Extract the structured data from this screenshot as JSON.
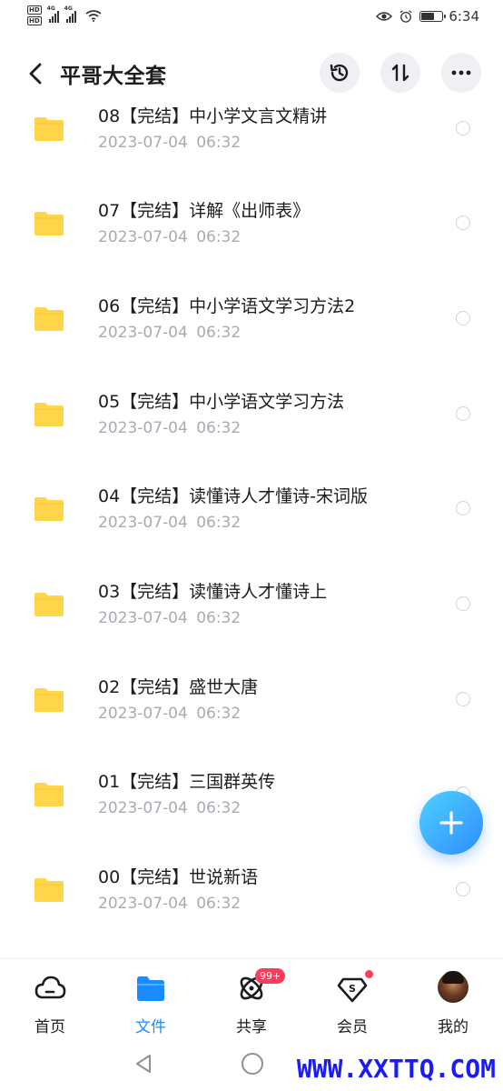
{
  "status_bar": {
    "hd1": "HD",
    "hd2": "HD",
    "net1": "4G",
    "net2": "4G",
    "time": "6:34",
    "battery_level": 0.55
  },
  "header": {
    "title": "平哥大全套"
  },
  "files": [
    {
      "name": "08【完结】中小学文言文精讲",
      "date": "2023-07-04  06:32"
    },
    {
      "name": "07【完结】详解《出师表》",
      "date": "2023-07-04  06:32"
    },
    {
      "name": "06【完结】中小学语文学习方法2",
      "date": "2023-07-04  06:32"
    },
    {
      "name": "05【完结】中小学语文学习方法",
      "date": "2023-07-04  06:32"
    },
    {
      "name": "04【完结】读懂诗人才懂诗-宋词版",
      "date": "2023-07-04  06:32"
    },
    {
      "name": "03【完结】读懂诗人才懂诗上",
      "date": "2023-07-04  06:32"
    },
    {
      "name": "02【完结】盛世大唐",
      "date": "2023-07-04  06:32"
    },
    {
      "name": "01【完结】三国群英传",
      "date": "2023-07-04  06:32"
    },
    {
      "name": "00【完结】世说新语",
      "date": "2023-07-04  06:32"
    }
  ],
  "bottom_nav": {
    "home": "首页",
    "files": "文件",
    "share": "共享",
    "share_badge": "99+",
    "vip": "会员",
    "mine": "我的"
  },
  "watermark": "WWW.XXTTQ.COM",
  "colors": {
    "accent": "#1b8cff",
    "folder": "#ffd54a",
    "badge": "#ff3b5c",
    "date_text": "#a9abb2"
  }
}
